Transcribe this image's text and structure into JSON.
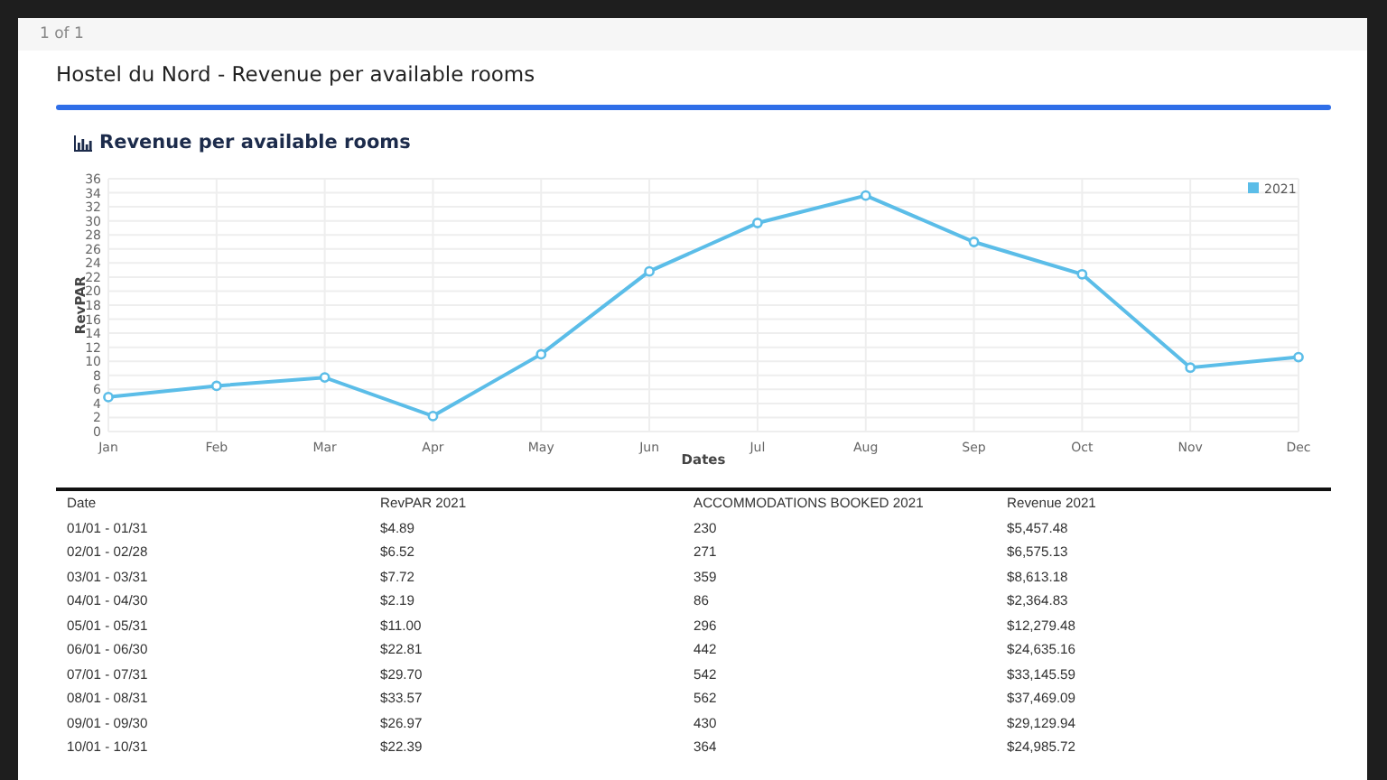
{
  "pager": "1 of 1",
  "report_title": "Hostel du Nord - Revenue per available rooms",
  "card": {
    "title": "Revenue per available rooms",
    "chart_data": {
      "type": "line",
      "xlabel": "Dates",
      "ylabel": "RevPAR",
      "categories": [
        "Jan",
        "Feb",
        "Mar",
        "Apr",
        "May",
        "Jun",
        "Jul",
        "Aug",
        "Sep",
        "Oct",
        "Nov",
        "Dec"
      ],
      "series": [
        {
          "name": "2021",
          "color": "#5bbde8",
          "marker": true,
          "values": [
            4.9,
            6.5,
            7.7,
            2.2,
            11.0,
            22.8,
            29.7,
            33.6,
            27.0,
            22.4,
            9.1,
            10.6
          ]
        }
      ],
      "grid": true,
      "ylim": [
        0,
        36
      ],
      "yticks": [
        0,
        2,
        4,
        6,
        8,
        10,
        12,
        14,
        16,
        18,
        20,
        22,
        24,
        26,
        28,
        30,
        32,
        34,
        36
      ]
    }
  },
  "table": {
    "columns": [
      "Date",
      "RevPAR 2021",
      "ACCOMMODATIONS BOOKED 2021",
      "Revenue 2021"
    ],
    "rows": [
      [
        "01/01 - 01/31",
        "$4.89",
        "230",
        "$5,457.48"
      ],
      [
        "02/01 - 02/28",
        "$6.52",
        "271",
        "$6,575.13"
      ],
      [
        "03/01 - 03/31",
        "$7.72",
        "359",
        "$8,613.18"
      ],
      [
        "04/01 - 04/30",
        "$2.19",
        "86",
        "$2,364.83"
      ],
      [
        "05/01 - 05/31",
        "$11.00",
        "296",
        "$12,279.48"
      ],
      [
        "06/01 - 06/30",
        "$22.81",
        "442",
        "$24,635.16"
      ],
      [
        "07/01 - 07/31",
        "$29.70",
        "542",
        "$33,145.59"
      ],
      [
        "08/01 - 08/31",
        "$33.57",
        "562",
        "$37,469.09"
      ],
      [
        "09/01 - 09/30",
        "$26.97",
        "430",
        "$29,129.94"
      ],
      [
        "10/01 - 10/31",
        "$22.39",
        "364",
        "$24,985.72"
      ]
    ]
  }
}
